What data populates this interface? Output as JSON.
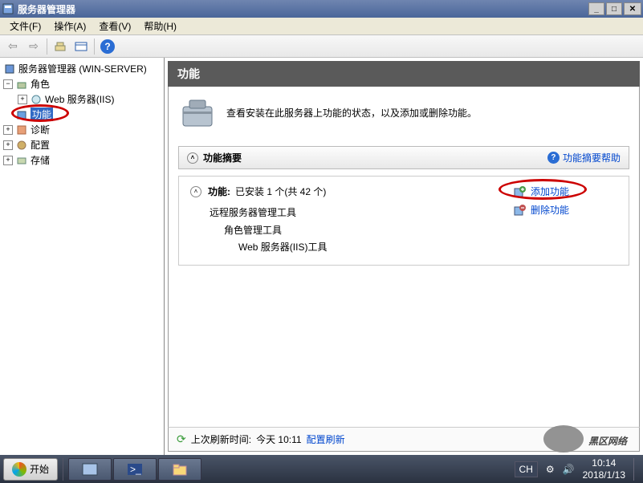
{
  "title": "服务器管理器",
  "menu": {
    "file": "文件(F)",
    "action": "操作(A)",
    "view": "查看(V)",
    "help": "帮助(H)"
  },
  "tree": {
    "root": "服务器管理器 (WIN-SERVER)",
    "roles": "角色",
    "iis": "Web 服务器(IIS)",
    "features": "功能",
    "diag": "诊断",
    "config": "配置",
    "storage": "存储"
  },
  "content": {
    "heading": "功能",
    "intro": "查看安装在此服务器上功能的状态，以及添加或删除功能。",
    "summary_title": "功能摘要",
    "summary_help": "功能摘要帮助",
    "installed_label": "功能:",
    "installed_value": "已安装 1 个(共 42 个)",
    "list1": "远程服务器管理工具",
    "list2": "角色管理工具",
    "list3": "Web 服务器(IIS)工具",
    "add_feature": "添加功能",
    "remove_feature": "删除功能",
    "last_refresh_label": "上次刷新时间:",
    "last_refresh_value": "今天 10:11",
    "config_refresh": "配置刷新"
  },
  "taskbar": {
    "start": "开始",
    "lang": "CH",
    "time": "10:14",
    "date": "2018/1/13"
  },
  "watermark": "黑区网络"
}
